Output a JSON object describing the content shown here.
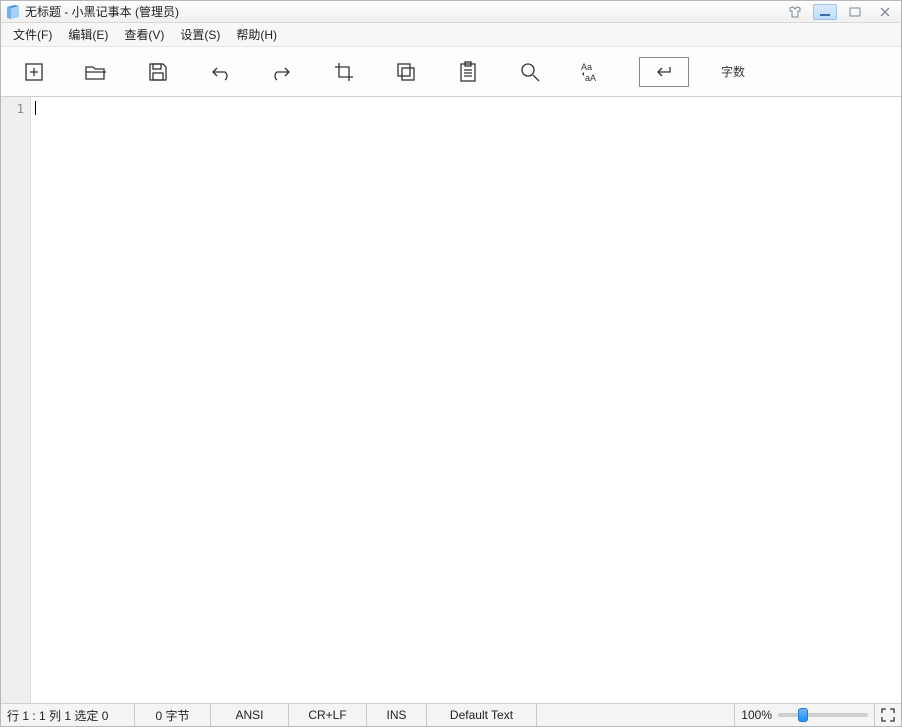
{
  "title": "无标题 - 小黑记事本 (管理员)",
  "menu": {
    "file": "文件(F)",
    "edit": "编辑(E)",
    "view": "查看(V)",
    "settings": "设置(S)",
    "help": "帮助(H)"
  },
  "toolbar": {
    "wordcount_label": "字数"
  },
  "editor": {
    "line1": "1"
  },
  "status": {
    "pos": "行 1 : 1  列 1  选定 0",
    "bytes": "0 字节",
    "encoding": "ANSI",
    "eol": "CR+LF",
    "ins": "INS",
    "lang": "Default Text",
    "zoom": "100%"
  }
}
